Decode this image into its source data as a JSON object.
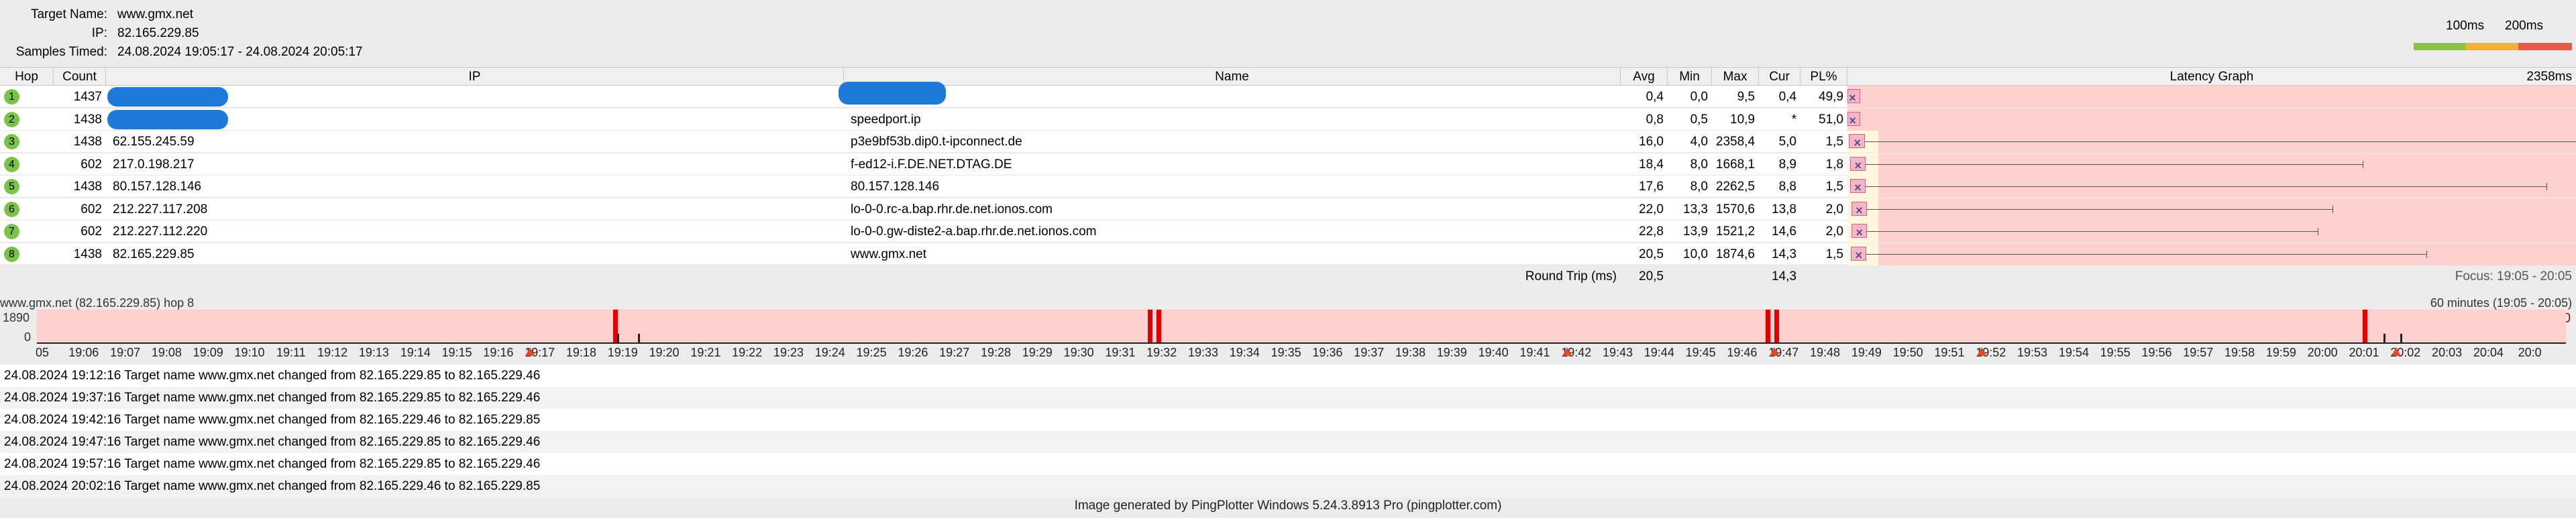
{
  "header": {
    "target_label": "Target Name:",
    "target_value": "www.gmx.net",
    "ip_label": "IP:",
    "ip_value": "82.165.229.85",
    "samples_label": "Samples Timed:",
    "samples_value": "24.08.2024 19:05:17 - 24.08.2024 20:05:17"
  },
  "latency_legend": {
    "label_100": "100ms",
    "label_200": "200ms",
    "colors": [
      "#8cc34b",
      "#f2b23a",
      "#e85a4a"
    ]
  },
  "table": {
    "columns": [
      "Hop",
      "Count",
      "IP",
      "Name",
      "Avg",
      "Min",
      "Max",
      "Cur",
      "PL%",
      "Latency Graph"
    ],
    "graph_max_label": "2358ms",
    "rows": [
      {
        "hop": "1",
        "count": "1437",
        "ip": "",
        "name": "",
        "avg": "0,4",
        "min": "0,0",
        "max": "9,5",
        "cur": "0,4",
        "pl": "49,9",
        "redacted_ip": true,
        "redacted_name": true
      },
      {
        "hop": "2",
        "count": "1438",
        "ip": "",
        "name": "speedport.ip",
        "avg": "0,8",
        "min": "0,5",
        "max": "10,9",
        "cur": "*",
        "pl": "51,0",
        "redacted_ip": true,
        "redacted_name": false
      },
      {
        "hop": "3",
        "count": "1438",
        "ip": "62.155.245.59",
        "name": "p3e9bf53b.dip0.t-ipconnect.de",
        "avg": "16,0",
        "min": "4,0",
        "max": "2358,4",
        "cur": "5,0",
        "pl": "1,5"
      },
      {
        "hop": "4",
        "count": "602",
        "ip": "217.0.198.217",
        "name": "f-ed12-i.F.DE.NET.DTAG.DE",
        "avg": "18,4",
        "min": "8,0",
        "max": "1668,1",
        "cur": "8,9",
        "pl": "1,8"
      },
      {
        "hop": "5",
        "count": "1438",
        "ip": "80.157.128.146",
        "name": "80.157.128.146",
        "avg": "17,6",
        "min": "8,0",
        "max": "2262,5",
        "cur": "8,8",
        "pl": "1,5"
      },
      {
        "hop": "6",
        "count": "602",
        "ip": "212.227.117.208",
        "name": "lo-0-0.rc-a.bap.rhr.de.net.ionos.com",
        "avg": "22,0",
        "min": "13,3",
        "max": "1570,6",
        "cur": "13,8",
        "pl": "2,0"
      },
      {
        "hop": "7",
        "count": "602",
        "ip": "212.227.112.220",
        "name": "lo-0-0.gw-diste2-a.bap.rhr.de.net.ionos.com",
        "avg": "22,8",
        "min": "13,9",
        "max": "1521,2",
        "cur": "14,6",
        "pl": "2,0"
      },
      {
        "hop": "8",
        "count": "1438",
        "ip": "82.165.229.85",
        "name": "www.gmx.net",
        "avg": "20,5",
        "min": "10,0",
        "max": "1874,6",
        "cur": "14,3",
        "pl": "1,5"
      }
    ],
    "round_trip_label": "Round Trip (ms)",
    "round_trip_avg": "20,5",
    "round_trip_cur": "14,3",
    "focus_label": "Focus: 19:05 - 20:05"
  },
  "timeline": {
    "title": "www.gmx.net (82.165.229.85) hop 8",
    "range_label": "60 minutes (19:05 - 20:05)",
    "y_max": "1890",
    "y_min": "0",
    "pl_max": "30",
    "ticks": [
      "05",
      "19:06",
      "19:07",
      "19:08",
      "19:09",
      "19:10",
      "19:11",
      "19:12",
      "19:13",
      "19:14",
      "19:15",
      "19:16",
      "19:17",
      "19:18",
      "19:19",
      "19:20",
      "19:21",
      "19:22",
      "19:23",
      "19:24",
      "19:25",
      "19:26",
      "19:27",
      "19:28",
      "19:29",
      "19:30",
      "19:31",
      "19:32",
      "19:33",
      "19:34",
      "19:35",
      "19:36",
      "19:37",
      "19:38",
      "19:39",
      "19:40",
      "19:41",
      "19:42",
      "19:43",
      "19:44",
      "19:45",
      "19:46",
      "19:47",
      "19:48",
      "19:49",
      "19:50",
      "19:51",
      "19:52",
      "19:53",
      "19:54",
      "19:55",
      "19:56",
      "19:57",
      "19:58",
      "19:59",
      "20:00",
      "20:01",
      "20:02",
      "20:03",
      "20:04",
      "20:0"
    ],
    "loss_minutes": [
      13.9,
      26.8,
      27.0,
      41.7,
      41.9,
      56.1
    ],
    "marker_minutes": [
      11.9,
      36.9,
      41.9,
      46.9,
      56.9,
      61.9
    ],
    "spike_minutes": [
      14.0,
      14.5,
      56.6,
      57.0
    ],
    "colors": {
      "loss": "#e00000",
      "marker": "#e04a2a",
      "band": "#fdd0d0"
    }
  },
  "log": [
    "24.08.2024 19:12:16 Target name www.gmx.net changed from 82.165.229.85 to 82.165.229.46",
    "24.08.2024 19:37:16 Target name www.gmx.net changed from 82.165.229.85 to 82.165.229.46",
    "24.08.2024 19:42:16 Target name www.gmx.net changed from 82.165.229.46 to 82.165.229.85",
    "24.08.2024 19:47:16 Target name www.gmx.net changed from 82.165.229.85 to 82.165.229.46",
    "24.08.2024 19:57:16 Target name www.gmx.net changed from 82.165.229.85 to 82.165.229.46",
    "24.08.2024 20:02:16 Target name www.gmx.net changed from 82.165.229.46 to 82.165.229.85"
  ],
  "footer": "Image generated by PingPlotter Windows 5.24.3.8913 Pro (pingplotter.com)"
}
